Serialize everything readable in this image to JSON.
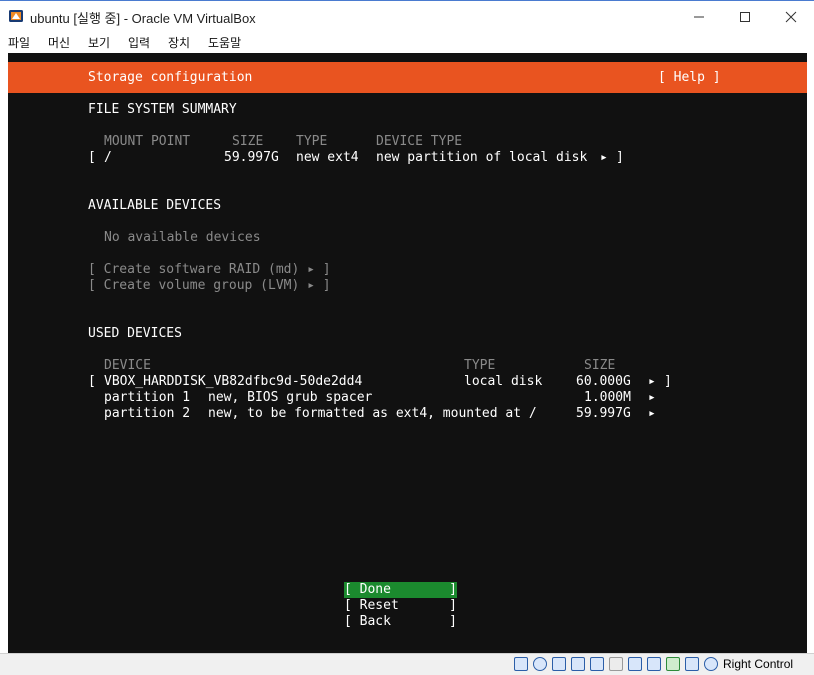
{
  "window": {
    "title": "ubuntu [실행 중] - Oracle VM VirtualBox",
    "controls": {
      "minimize": "—",
      "maximize": "☐",
      "close": "✕"
    }
  },
  "menu": [
    "파일",
    "머신",
    "보기",
    "입력",
    "장치",
    "도움말"
  ],
  "installer": {
    "title": "Storage configuration",
    "help": "[ Help ]",
    "fs_summary": {
      "heading": "FILE SYSTEM SUMMARY",
      "columns": [
        "MOUNT POINT",
        "SIZE",
        "TYPE",
        "DEVICE TYPE"
      ],
      "rows": [
        {
          "open": "[",
          "mount": "/",
          "size": "59.997G",
          "type": "new ext4",
          "device_type": "new partition of local disk",
          "arrow": "▸",
          "close": "]"
        }
      ]
    },
    "available": {
      "heading": "AVAILABLE DEVICES",
      "empty": "No available devices",
      "actions": [
        "[ Create software RAID (md) ▸ ]",
        "[ Create volume group (LVM) ▸ ]"
      ]
    },
    "used": {
      "heading": "USED DEVICES",
      "columns": [
        "DEVICE",
        "TYPE",
        "SIZE"
      ],
      "disk": {
        "open": "[",
        "name": "VBOX_HARDDISK_VB82dfbc9d-50de2dd4",
        "type": "local disk",
        "size": "60.000G",
        "arrow": "▸",
        "close": "]"
      },
      "partitions": [
        {
          "name": "partition 1",
          "desc": "new, BIOS grub spacer",
          "size": "1.000M",
          "arrow": "▸"
        },
        {
          "name": "partition 2",
          "desc": "new, to be formatted as ext4, mounted at /",
          "size": "59.997G",
          "arrow": "▸"
        }
      ]
    },
    "buttons": [
      {
        "label": "[ Done",
        "close": "]"
      },
      {
        "label": "[ Reset",
        "close": "]"
      },
      {
        "label": "[ Back",
        "close": "]"
      }
    ]
  },
  "statusbar": {
    "host_key": "Right Control"
  },
  "colors": {
    "header": "#e95420",
    "focus": "#1b8a2e",
    "background": "#111111"
  }
}
